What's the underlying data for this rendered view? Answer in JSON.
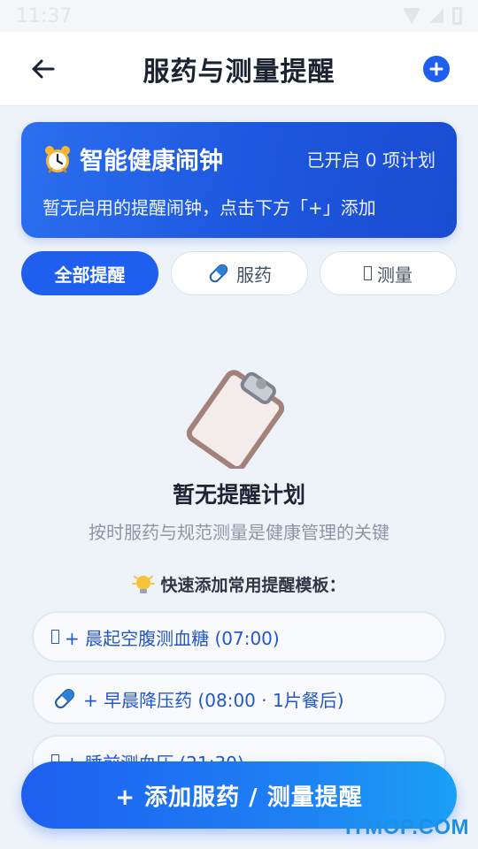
{
  "status_bar": {
    "time": "11:37"
  },
  "header": {
    "title": "服药与测量提醒"
  },
  "alarm_card": {
    "title": "智能健康闹钟",
    "status": "已开启 0 项计划",
    "description": "暂无启用的提醒闹钟，点击下方「+」添加"
  },
  "tabs": [
    {
      "label": "全部提醒",
      "active": true
    },
    {
      "label": "服药",
      "icon": "pill-icon",
      "active": false
    },
    {
      "label": "测量",
      "icon": "missing-glyph-icon",
      "active": false
    }
  ],
  "empty_state": {
    "title": "暂无提醒计划",
    "subtitle": "按时服药与规范测量是健康管理的关键"
  },
  "quick_add": {
    "header": "快速添加常用提醒模板：",
    "templates": [
      {
        "label": "+ 晨起空腹测血糖 (07:00)",
        "icon": "missing-glyph-icon"
      },
      {
        "label": "+ 早晨降压药 (08:00 · 1片餐后)",
        "icon": "pill-icon"
      },
      {
        "label": "+ 睡前测血压 (21:30)",
        "icon": "missing-glyph-icon"
      }
    ]
  },
  "cta": {
    "label": "+ 添加服药 / 测量提醒"
  },
  "watermark": "ITMOP.COM",
  "colors": {
    "primary": "#1e5ff0",
    "background": "#eef3fa",
    "template_text": "#2357c9"
  }
}
